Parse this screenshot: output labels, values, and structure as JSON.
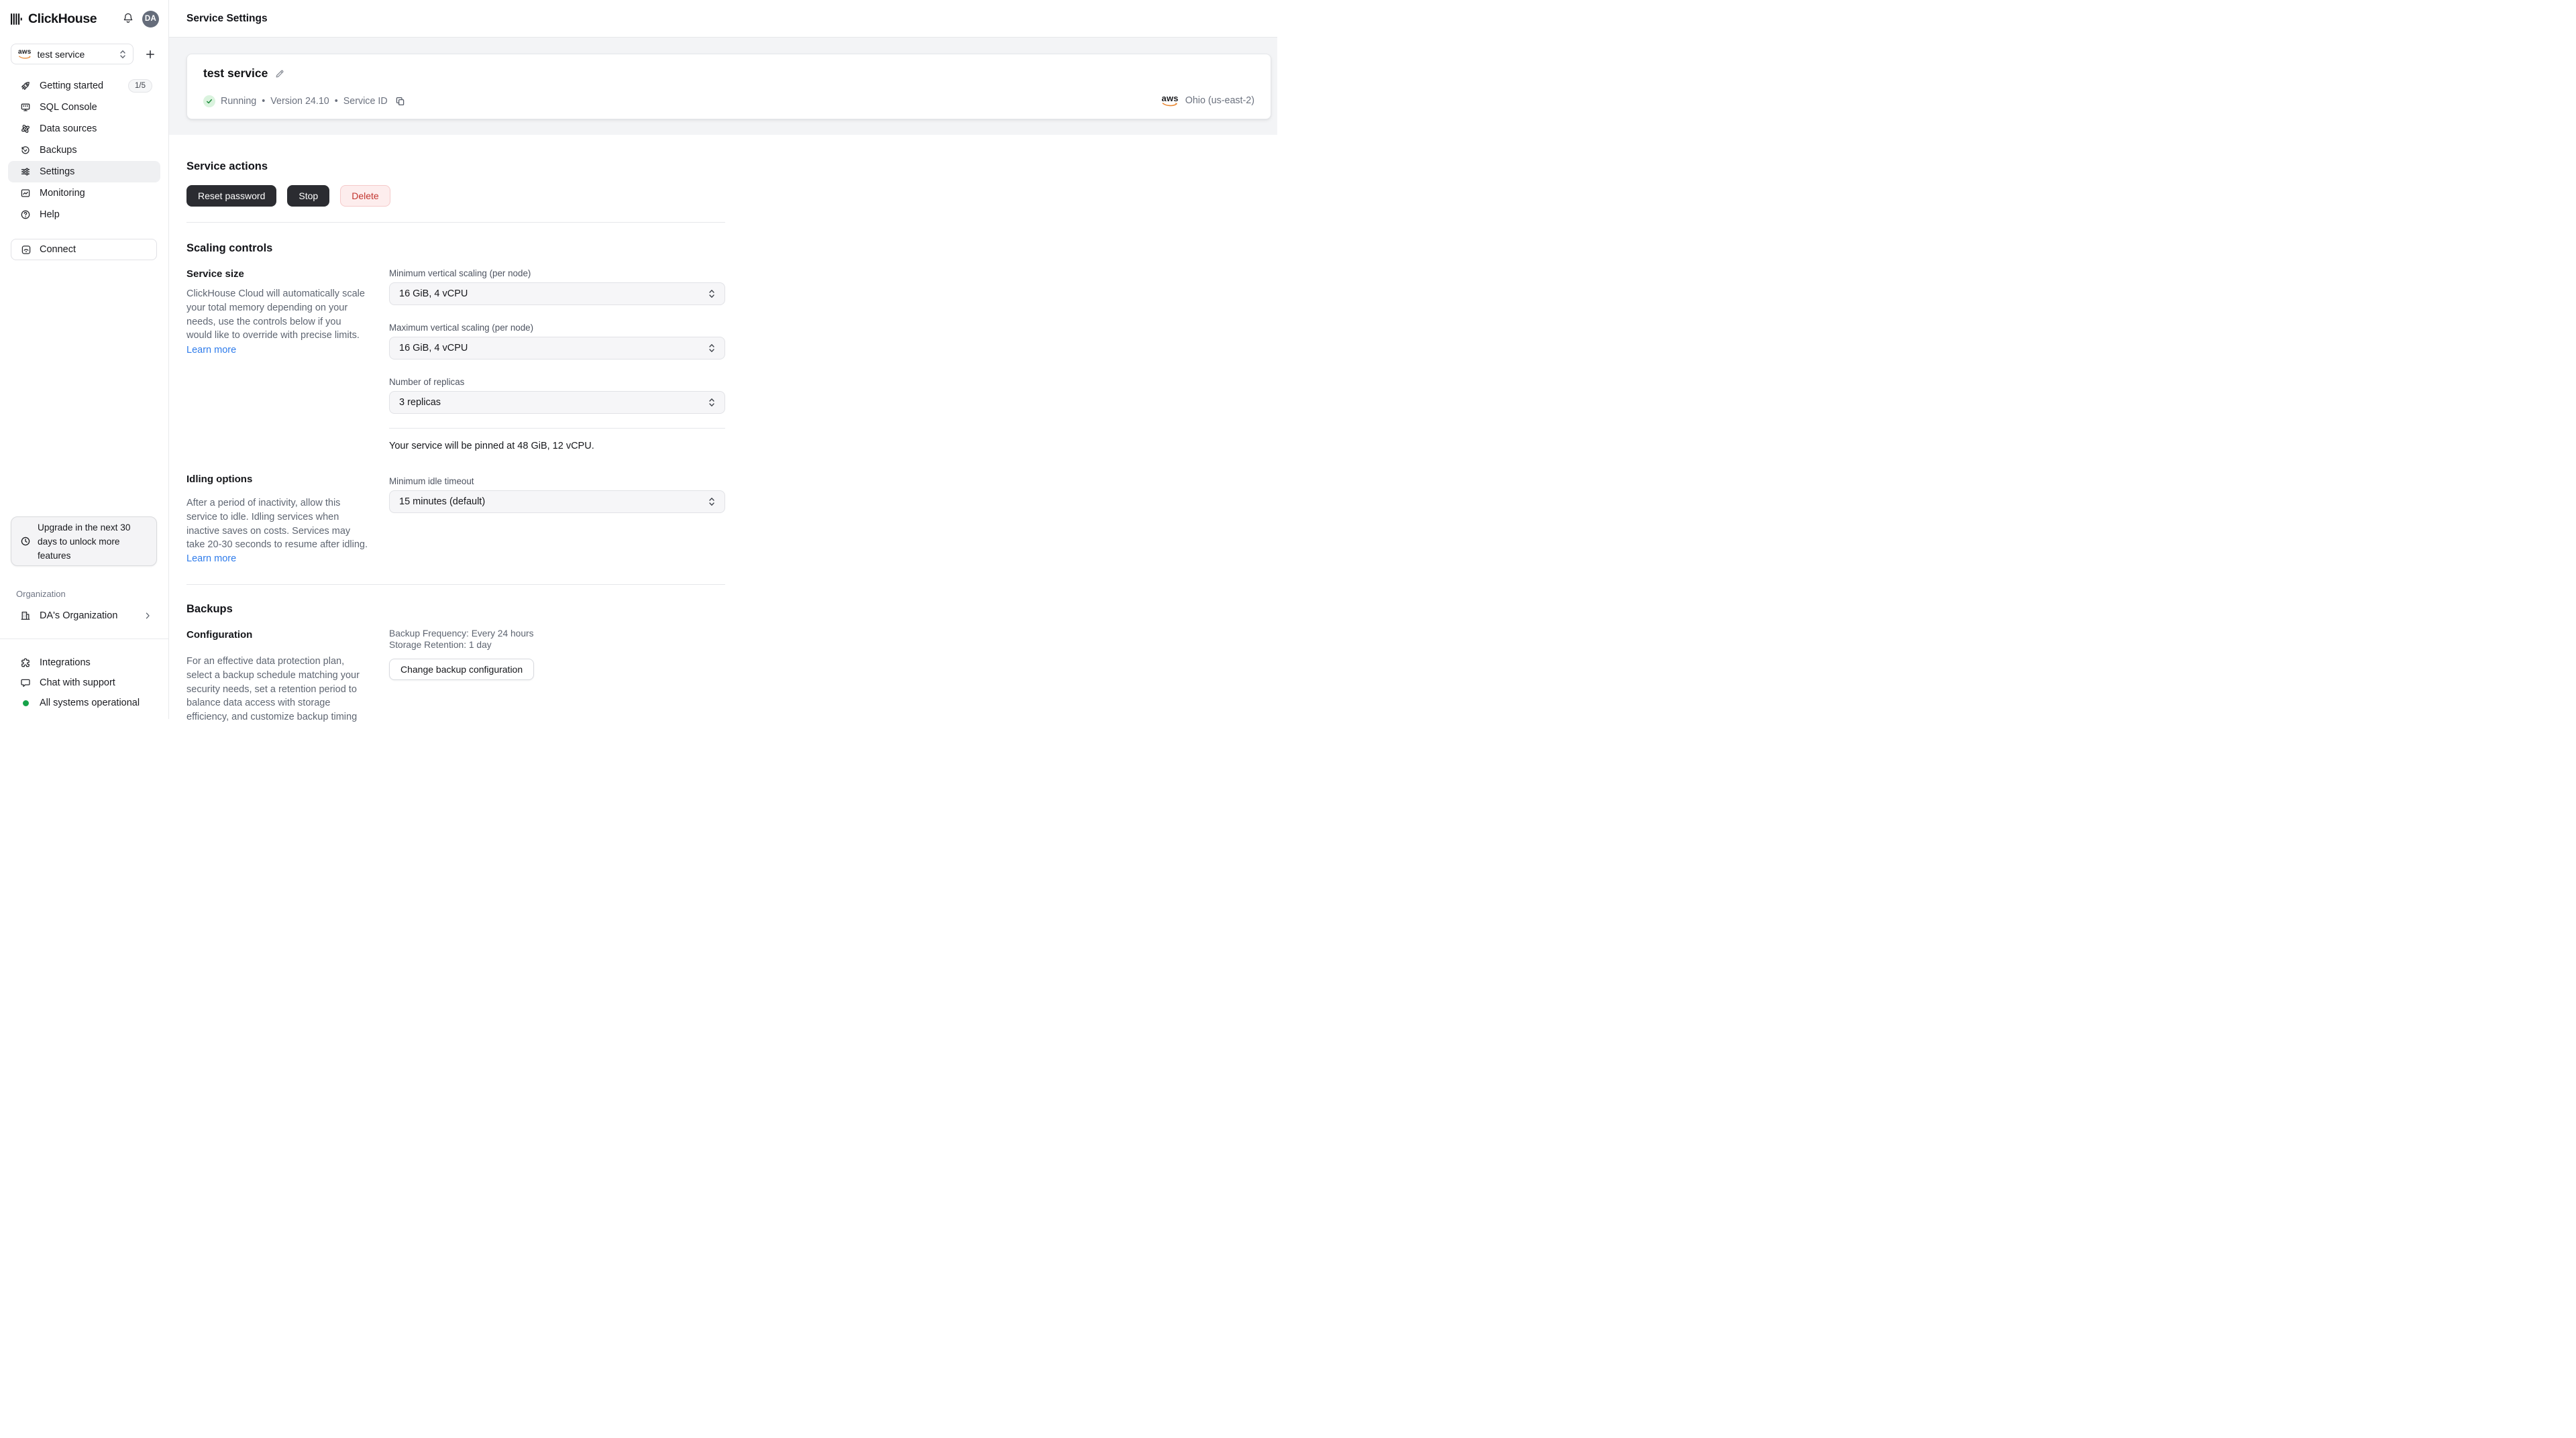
{
  "brand": {
    "name": "ClickHouse"
  },
  "topbar": {
    "avatar_initials": "DA"
  },
  "sidebar": {
    "service_selector": {
      "value": "test service",
      "provider": "aws"
    },
    "add_service_label": "+",
    "nav": [
      {
        "label": "Getting started",
        "badge": "1/5"
      },
      {
        "label": "SQL Console"
      },
      {
        "label": "Data sources"
      },
      {
        "label": "Backups"
      },
      {
        "label": "Settings"
      },
      {
        "label": "Monitoring"
      },
      {
        "label": "Help"
      }
    ],
    "connect_label": "Connect",
    "upgrade_notice": "Upgrade in the next 30 days to unlock more features",
    "organization_section_label": "Organization",
    "organization_name": "DA's Organization",
    "footer": {
      "integrations": "Integrations",
      "chat": "Chat with support",
      "status": "All systems operational"
    }
  },
  "header": {
    "title": "Service Settings"
  },
  "service_card": {
    "name": "test service",
    "status": "Running",
    "separator": "•",
    "version_label": "Version 24.10",
    "service_id_label": "Service ID",
    "provider": "aws",
    "region": "Ohio (us-east-2)"
  },
  "service_actions": {
    "heading": "Service actions",
    "reset_password": "Reset password",
    "stop": "Stop",
    "delete": "Delete"
  },
  "scaling": {
    "heading": "Scaling controls",
    "service_size_heading": "Service size",
    "service_size_description": "ClickHouse Cloud will automatically scale your total memory depending on your needs, use the controls below if you would like to override with precise limits.",
    "learn_more": "Learn more",
    "min_label": "Minimum vertical scaling (per node)",
    "min_value": "16 GiB, 4 vCPU",
    "max_label": "Maximum vertical scaling (per node)",
    "max_value": "16 GiB, 4 vCPU",
    "replicas_label": "Number of replicas",
    "replicas_value": "3 replicas",
    "pinned_summary": "Your service will be pinned at 48 GiB, 12 vCPU."
  },
  "idling": {
    "heading": "Idling options",
    "description": "After a period of inactivity, allow this service to idle. Idling services when inactive saves on costs. Services may take 20-30 seconds to resume after idling.",
    "learn_more": "Learn more",
    "timeout_label": "Minimum idle timeout",
    "timeout_value": "15 minutes (default)"
  },
  "backups": {
    "heading": "Backups",
    "config_heading": "Configuration",
    "description": "For an effective data protection plan, select a backup schedule matching your security needs, set a retention period to balance data access with storage efficiency, and customize backup timing",
    "frequency": "Backup Frequency: Every 24 hours",
    "retention": "Storage Retention: 1 day",
    "change_button": "Change backup configuration"
  },
  "colors": {
    "status_green": "#17a34a",
    "running_badge_bg": "#daf3de",
    "running_check": "#1d8a3c",
    "delete_red": "#c2352f",
    "delete_bg": "#fdeded",
    "link_blue": "#2f7ceb",
    "dark_button": "#2b2c31",
    "band_gray": "#f3f4f6",
    "aws_orange": "#e8842c"
  }
}
